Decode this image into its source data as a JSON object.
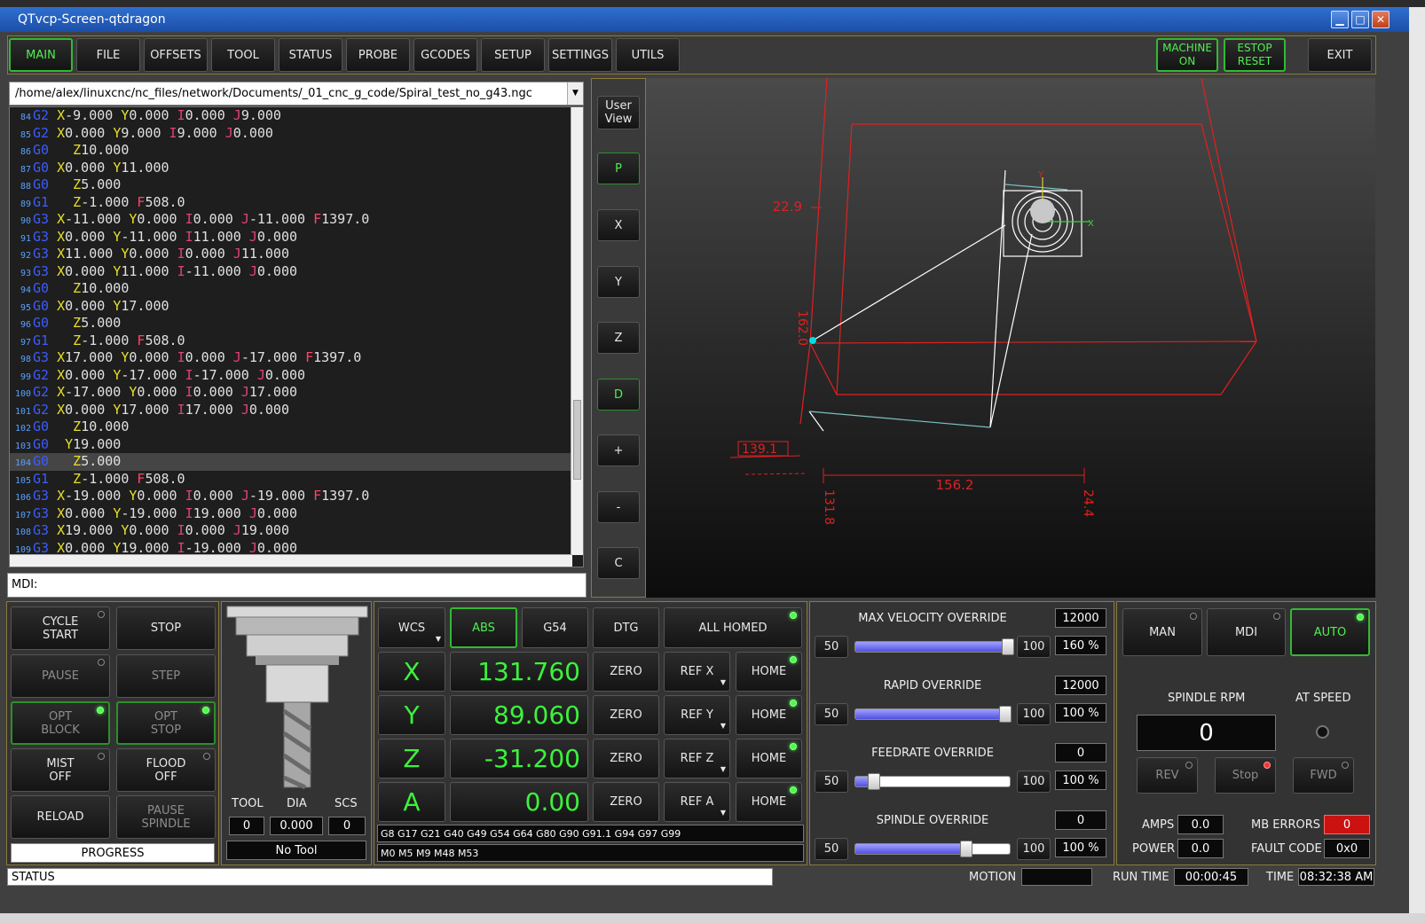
{
  "window": {
    "title": "QTvcp-Screen-qtdragon",
    "min_icon": "minimize-icon",
    "max_icon": "maximize-icon",
    "close_icon": "close-icon"
  },
  "tabs": [
    "MAIN",
    "FILE",
    "OFFSETS",
    "TOOL",
    "STATUS",
    "PROBE",
    "GCODES",
    "SETUP",
    "SETTINGS",
    "UTILS"
  ],
  "top_right": {
    "machine_on": "MACHINE\nON",
    "estop_reset": "ESTOP\nRESET",
    "exit": "EXIT"
  },
  "file_path": "/home/alex/linuxcnc/nc_files/network/Documents/_01_cnc_g_code/Spiral_test_no_g43.ngc",
  "gcode_lines": [
    {
      "n": "84",
      "parts": [
        [
          "G2 ",
          "g"
        ],
        [
          "X",
          "a"
        ],
        [
          "-9.000 ",
          "v"
        ],
        [
          "Y",
          "a"
        ],
        [
          "0.000 ",
          "v"
        ],
        [
          "I",
          "i"
        ],
        [
          "0.000 ",
          "v"
        ],
        [
          "J",
          "i"
        ],
        [
          "9.000",
          "v"
        ]
      ]
    },
    {
      "n": "85",
      "parts": [
        [
          "G2 ",
          "g"
        ],
        [
          "X",
          "a"
        ],
        [
          "0.000 ",
          "v"
        ],
        [
          "Y",
          "a"
        ],
        [
          "9.000 ",
          "v"
        ],
        [
          "I",
          "i"
        ],
        [
          "9.000 ",
          "v"
        ],
        [
          "J",
          "i"
        ],
        [
          "0.000",
          "v"
        ]
      ]
    },
    {
      "n": "86",
      "parts": [
        [
          "G0 ",
          "g"
        ],
        [
          "  Z",
          "a"
        ],
        [
          "10.000",
          "v"
        ]
      ]
    },
    {
      "n": "87",
      "parts": [
        [
          "G0 ",
          "g"
        ],
        [
          "X",
          "a"
        ],
        [
          "0.000 ",
          "v"
        ],
        [
          "Y",
          "a"
        ],
        [
          "11.000",
          "v"
        ]
      ]
    },
    {
      "n": "88",
      "parts": [
        [
          "G0 ",
          "g"
        ],
        [
          "  Z",
          "a"
        ],
        [
          "5.000",
          "v"
        ]
      ]
    },
    {
      "n": "89",
      "parts": [
        [
          "G1 ",
          "g"
        ],
        [
          "  Z",
          "a"
        ],
        [
          "-1.000 ",
          "v"
        ],
        [
          "F",
          "f"
        ],
        [
          "508.0",
          "v"
        ]
      ]
    },
    {
      "n": "90",
      "parts": [
        [
          "G3 ",
          "g"
        ],
        [
          "X",
          "a"
        ],
        [
          "-11.000 ",
          "v"
        ],
        [
          "Y",
          "a"
        ],
        [
          "0.000 ",
          "v"
        ],
        [
          "I",
          "i"
        ],
        [
          "0.000 ",
          "v"
        ],
        [
          "J",
          "i"
        ],
        [
          "-11.000 ",
          "v"
        ],
        [
          "F",
          "f"
        ],
        [
          "1397.0",
          "v"
        ]
      ]
    },
    {
      "n": "91",
      "parts": [
        [
          "G3 ",
          "g"
        ],
        [
          "X",
          "a"
        ],
        [
          "0.000 ",
          "v"
        ],
        [
          "Y",
          "a"
        ],
        [
          "-11.000 ",
          "v"
        ],
        [
          "I",
          "i"
        ],
        [
          "11.000 ",
          "v"
        ],
        [
          "J",
          "i"
        ],
        [
          "0.000",
          "v"
        ]
      ]
    },
    {
      "n": "92",
      "parts": [
        [
          "G3 ",
          "g"
        ],
        [
          "X",
          "a"
        ],
        [
          "11.000 ",
          "v"
        ],
        [
          "Y",
          "a"
        ],
        [
          "0.000 ",
          "v"
        ],
        [
          "I",
          "i"
        ],
        [
          "0.000 ",
          "v"
        ],
        [
          "J",
          "i"
        ],
        [
          "11.000",
          "v"
        ]
      ]
    },
    {
      "n": "93",
      "parts": [
        [
          "G3 ",
          "g"
        ],
        [
          "X",
          "a"
        ],
        [
          "0.000 ",
          "v"
        ],
        [
          "Y",
          "a"
        ],
        [
          "11.000 ",
          "v"
        ],
        [
          "I",
          "i"
        ],
        [
          "-11.000 ",
          "v"
        ],
        [
          "J",
          "i"
        ],
        [
          "0.000",
          "v"
        ]
      ]
    },
    {
      "n": "94",
      "parts": [
        [
          "G0 ",
          "g"
        ],
        [
          "  Z",
          "a"
        ],
        [
          "10.000",
          "v"
        ]
      ]
    },
    {
      "n": "95",
      "parts": [
        [
          "G0 ",
          "g"
        ],
        [
          "X",
          "a"
        ],
        [
          "0.000 ",
          "v"
        ],
        [
          "Y",
          "a"
        ],
        [
          "17.000",
          "v"
        ]
      ]
    },
    {
      "n": "96",
      "parts": [
        [
          "G0 ",
          "g"
        ],
        [
          "  Z",
          "a"
        ],
        [
          "5.000",
          "v"
        ]
      ]
    },
    {
      "n": "97",
      "parts": [
        [
          "G1 ",
          "g"
        ],
        [
          "  Z",
          "a"
        ],
        [
          "-1.000 ",
          "v"
        ],
        [
          "F",
          "f"
        ],
        [
          "508.0",
          "v"
        ]
      ]
    },
    {
      "n": "98",
      "parts": [
        [
          "G3 ",
          "g"
        ],
        [
          "X",
          "a"
        ],
        [
          "17.000 ",
          "v"
        ],
        [
          "Y",
          "a"
        ],
        [
          "0.000 ",
          "v"
        ],
        [
          "I",
          "i"
        ],
        [
          "0.000 ",
          "v"
        ],
        [
          "J",
          "i"
        ],
        [
          "-17.000 ",
          "v"
        ],
        [
          "F",
          "f"
        ],
        [
          "1397.0",
          "v"
        ]
      ]
    },
    {
      "n": "99",
      "parts": [
        [
          "G2 ",
          "g"
        ],
        [
          "X",
          "a"
        ],
        [
          "0.000 ",
          "v"
        ],
        [
          "Y",
          "a"
        ],
        [
          "-17.000 ",
          "v"
        ],
        [
          "I",
          "i"
        ],
        [
          "-17.000 ",
          "v"
        ],
        [
          "J",
          "i"
        ],
        [
          "0.000",
          "v"
        ]
      ]
    },
    {
      "n": "100",
      "parts": [
        [
          "G2 ",
          "g"
        ],
        [
          "X",
          "a"
        ],
        [
          "-17.000 ",
          "v"
        ],
        [
          "Y",
          "a"
        ],
        [
          "0.000 ",
          "v"
        ],
        [
          "I",
          "i"
        ],
        [
          "0.000 ",
          "v"
        ],
        [
          "J",
          "i"
        ],
        [
          "17.000",
          "v"
        ]
      ]
    },
    {
      "n": "101",
      "parts": [
        [
          "G2 ",
          "g"
        ],
        [
          "X",
          "a"
        ],
        [
          "0.000 ",
          "v"
        ],
        [
          "Y",
          "a"
        ],
        [
          "17.000 ",
          "v"
        ],
        [
          "I",
          "i"
        ],
        [
          "17.000 ",
          "v"
        ],
        [
          "J",
          "i"
        ],
        [
          "0.000",
          "v"
        ]
      ]
    },
    {
      "n": "102",
      "parts": [
        [
          "G0 ",
          "g"
        ],
        [
          "  Z",
          "a"
        ],
        [
          "10.000",
          "v"
        ]
      ]
    },
    {
      "n": "103",
      "parts": [
        [
          "G0 ",
          "g"
        ],
        [
          " Y",
          "a"
        ],
        [
          "19.000",
          "v"
        ]
      ]
    },
    {
      "n": "104",
      "parts": [
        [
          "G0 ",
          "g"
        ],
        [
          "  Z",
          "a"
        ],
        [
          "5.000",
          "v"
        ]
      ],
      "current": true
    },
    {
      "n": "105",
      "parts": [
        [
          "G1 ",
          "g"
        ],
        [
          "  Z",
          "a"
        ],
        [
          "-1.000 ",
          "v"
        ],
        [
          "F",
          "f"
        ],
        [
          "508.0",
          "v"
        ]
      ]
    },
    {
      "n": "106",
      "parts": [
        [
          "G3 ",
          "g"
        ],
        [
          "X",
          "a"
        ],
        [
          "-19.000 ",
          "v"
        ],
        [
          "Y",
          "a"
        ],
        [
          "0.000 ",
          "v"
        ],
        [
          "I",
          "i"
        ],
        [
          "0.000 ",
          "v"
        ],
        [
          "J",
          "i"
        ],
        [
          "-19.000 ",
          "v"
        ],
        [
          "F",
          "f"
        ],
        [
          "1397.0",
          "v"
        ]
      ]
    },
    {
      "n": "107",
      "parts": [
        [
          "G3 ",
          "g"
        ],
        [
          "X",
          "a"
        ],
        [
          "0.000 ",
          "v"
        ],
        [
          "Y",
          "a"
        ],
        [
          "-19.000 ",
          "v"
        ],
        [
          "I",
          "i"
        ],
        [
          "19.000 ",
          "v"
        ],
        [
          "J",
          "i"
        ],
        [
          "0.000",
          "v"
        ]
      ]
    },
    {
      "n": "108",
      "parts": [
        [
          "G3 ",
          "g"
        ],
        [
          "X",
          "a"
        ],
        [
          "19.000 ",
          "v"
        ],
        [
          "Y",
          "a"
        ],
        [
          "0.000 ",
          "v"
        ],
        [
          "I",
          "i"
        ],
        [
          "0.000 ",
          "v"
        ],
        [
          "J",
          "i"
        ],
        [
          "19.000",
          "v"
        ]
      ]
    },
    {
      "n": "109",
      "parts": [
        [
          "G3 ",
          "g"
        ],
        [
          "X",
          "a"
        ],
        [
          "0.000 ",
          "v"
        ],
        [
          "Y",
          "a"
        ],
        [
          "19.000 ",
          "v"
        ],
        [
          "I",
          "i"
        ],
        [
          "-19.000 ",
          "v"
        ],
        [
          "J",
          "i"
        ],
        [
          "0.000",
          "v"
        ]
      ]
    }
  ],
  "mdi_label": "MDI:",
  "view_buttons": [
    "User\nView",
    "P",
    "X",
    "Y",
    "Z",
    "D",
    "+",
    "-",
    "C"
  ],
  "graphics": {
    "dim_x": "156.2",
    "dim_left": "22.9",
    "dim_y": "162.0",
    "dim_z_a": "139.1",
    "dim_z_b": "131.8",
    "dim_right": "24.4",
    "axis_y": "Y",
    "axis_x": "X"
  },
  "controls": {
    "cycle_start": "CYCLE\nSTART",
    "stop": "STOP",
    "pause": "PAUSE",
    "step": "STEP",
    "opt_block": "OPT\nBLOCK",
    "opt_stop": "OPT\nSTOP",
    "mist": "MIST\nOFF",
    "flood": "FLOOD\nOFF",
    "reload": "RELOAD",
    "pause_spindle": "PAUSE\nSPINDLE",
    "progress": "PROGRESS"
  },
  "tool": {
    "tool_label": "TOOL",
    "dia_label": "DIA",
    "scs_label": "SCS",
    "tool": "0",
    "dia": "0.000",
    "scs": "0",
    "name": "No Tool"
  },
  "dro": {
    "wcs": "WCS",
    "abs": "ABS",
    "g54": "G54",
    "dtg": "DTG",
    "all_homed": "ALL HOMED",
    "axes": [
      {
        "name": "X",
        "value": "131.760",
        "zero": "ZERO",
        "ref": "REF X",
        "home": "HOME"
      },
      {
        "name": "Y",
        "value": "89.060",
        "zero": "ZERO",
        "ref": "REF Y",
        "home": "HOME"
      },
      {
        "name": "Z",
        "value": "-31.200",
        "zero": "ZERO",
        "ref": "REF Z",
        "home": "HOME"
      },
      {
        "name": "A",
        "value": "0.00",
        "zero": "ZERO",
        "ref": "REF A",
        "home": "HOME"
      }
    ],
    "gcodes": "G8 G17 G21 G40 G49 G54 G64 G80 G90 G91.1 G94 G97 G99",
    "mcodes": "M0 M5 M9 M48 M53"
  },
  "overrides": [
    {
      "title": "MAX VELOCITY OVERRIDE",
      "value": "12000",
      "min": "50",
      "max": "100",
      "pct": "160 %",
      "fill": 0.99
    },
    {
      "title": "RAPID OVERRIDE",
      "value": "12000",
      "min": "50",
      "max": "100",
      "pct": "100 %",
      "fill": 0.97
    },
    {
      "title": "FEEDRATE OVERRIDE",
      "value": "0",
      "min": "50",
      "max": "100",
      "pct": "100 %",
      "fill": 0.12
    },
    {
      "title": "SPINDLE OVERRIDE",
      "value": "0",
      "min": "50",
      "max": "100",
      "pct": "100 %",
      "fill": 0.72
    }
  ],
  "spindle": {
    "man": "MAN",
    "mdi": "MDI",
    "auto": "AUTO",
    "rpm_label": "SPINDLE RPM",
    "at_speed": "AT SPEED",
    "rpm": "0",
    "rev": "REV",
    "stop": "Stop",
    "fwd": "FWD",
    "amps_label": "AMPS",
    "amps": "0.0",
    "power_label": "POWER",
    "power": "0.0",
    "mb_errors_label": "MB ERRORS",
    "mb_errors": "0",
    "fault_label": "FAULT CODE",
    "fault": "0x0"
  },
  "statusbar": {
    "status": "STATUS",
    "motion_label": "MOTION",
    "motion": "",
    "runtime_label": "RUN TIME",
    "runtime": "00:00:45",
    "time_label": "TIME",
    "time": "08:32:38 AM"
  },
  "colors": {
    "g": "#3a5cff",
    "a": "#e8e028",
    "v": "#e0e0e0",
    "i": "#e0407a",
    "f": "#ff4466",
    "accent": "#4ff04f",
    "graphics_red": "#e02020"
  }
}
